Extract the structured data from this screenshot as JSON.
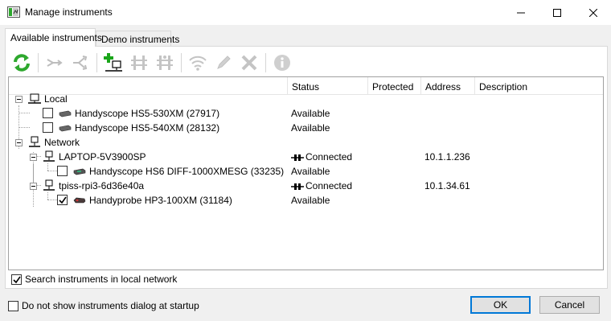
{
  "window": {
    "title": "Manage instruments"
  },
  "tabs": [
    {
      "label": "Available instruments",
      "active": true
    },
    {
      "label": "Demo instruments",
      "active": false
    }
  ],
  "toolbar": {
    "buttons": [
      {
        "icon": "refresh-icon",
        "enabled": true
      },
      {
        "icon": "combine-icon",
        "enabled": false
      },
      {
        "icon": "split-icon",
        "enabled": false
      },
      {
        "icon": "add-network-instrument-icon",
        "enabled": true
      },
      {
        "icon": "sync-instruments-icon",
        "enabled": false
      },
      {
        "icon": "sync-instruments-2-icon",
        "enabled": false
      },
      {
        "icon": "wifi-icon",
        "enabled": false
      },
      {
        "icon": "edit-icon",
        "enabled": false
      },
      {
        "icon": "delete-icon",
        "enabled": false
      },
      {
        "icon": "info-icon",
        "enabled": false
      }
    ]
  },
  "columns": {
    "name": "",
    "status": "Status",
    "protected": "Protected",
    "address": "Address",
    "description": "Description"
  },
  "rows": [
    {
      "name": "Local",
      "status": "",
      "address": "",
      "kind": "group"
    },
    {
      "name": "Handyscope HS5-530XM (27917)",
      "status": "Available",
      "address": "",
      "kind": "device",
      "checked": false
    },
    {
      "name": "Handyscope HS5-540XM (28132)",
      "status": "Available",
      "address": "",
      "kind": "device",
      "checked": false
    },
    {
      "name": "Network",
      "status": "",
      "address": "",
      "kind": "group"
    },
    {
      "name": "LAPTOP-5V3900SP",
      "status": "Connected",
      "address": "10.1.1.236",
      "kind": "server"
    },
    {
      "name": "Handyscope HS6 DIFF-1000XMESG (33235)",
      "status": "Available",
      "address": "",
      "kind": "device",
      "checked": false
    },
    {
      "name": "tpiss-rpi3-6d36e40a",
      "status": "Connected",
      "address": "10.1.34.61",
      "kind": "server"
    },
    {
      "name": "Handyprobe HP3-100XM (31184)",
      "status": "Available",
      "address": "",
      "kind": "probe",
      "checked": true
    }
  ],
  "options": {
    "search_local_network": {
      "label": "Search instruments in local network",
      "checked": true
    },
    "hide_at_startup": {
      "label": "Do not show instruments dialog at startup",
      "checked": false
    }
  },
  "buttons": {
    "ok": "OK",
    "cancel": "Cancel"
  },
  "colors": {
    "accent": "#0078d7",
    "refresh_green": "#2ea82e",
    "add_green": "#1aa51a"
  }
}
